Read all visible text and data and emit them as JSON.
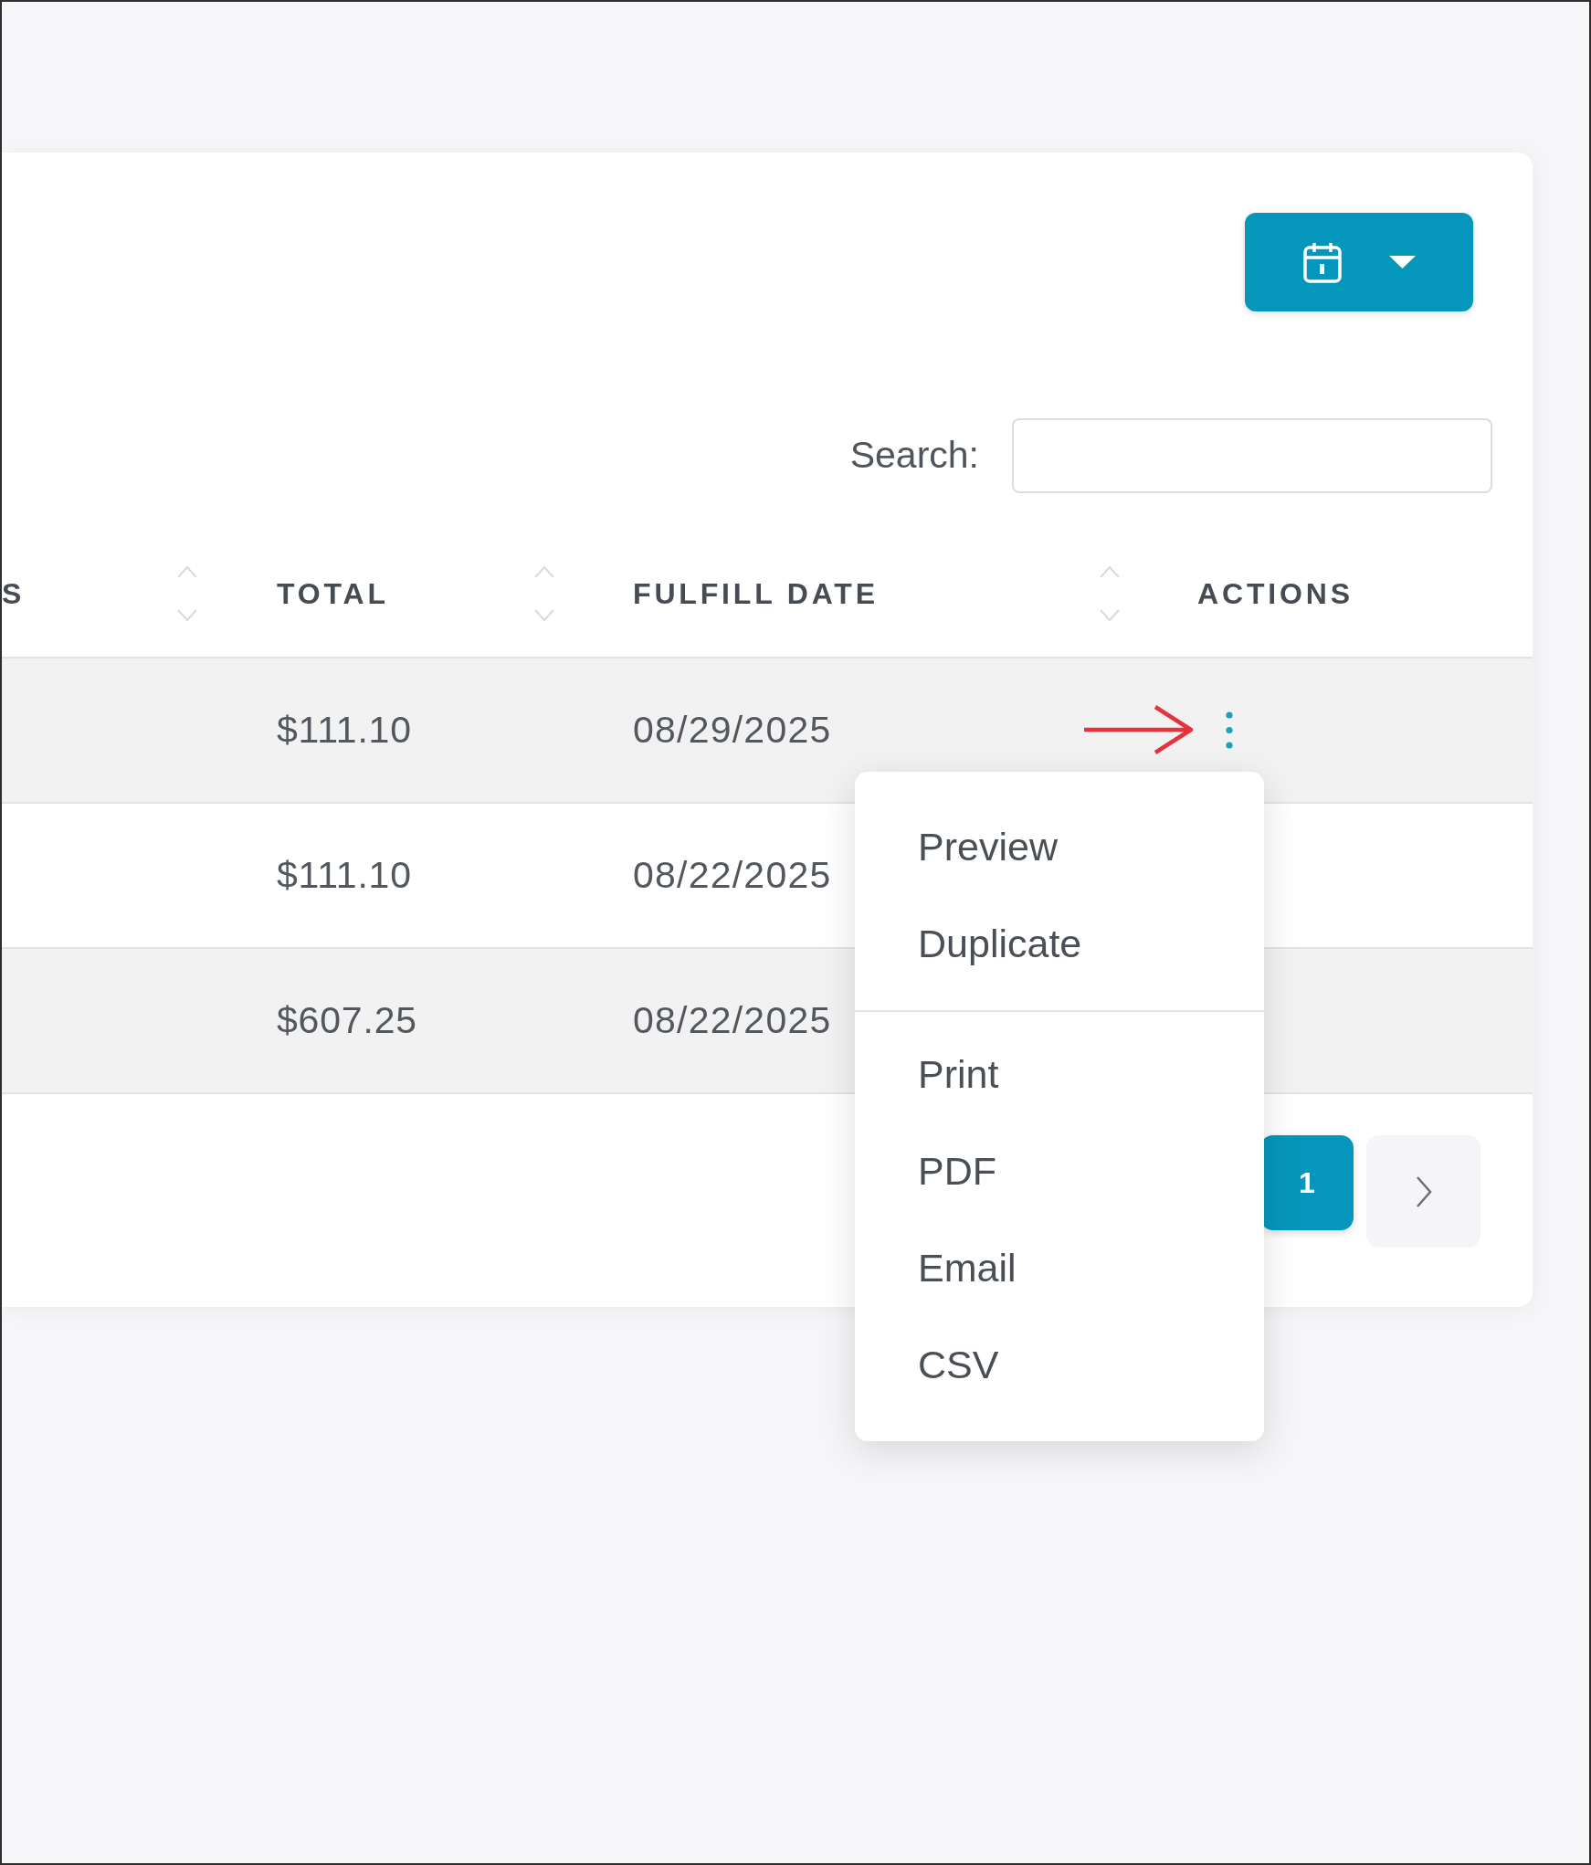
{
  "search": {
    "label": "Search:"
  },
  "table": {
    "columns": [
      {
        "label": "S",
        "sortable": true
      },
      {
        "label": "TOTAL",
        "sortable": true
      },
      {
        "label": "FULFILL DATE",
        "sortable": true
      },
      {
        "label": "ACTIONS",
        "sortable": false
      }
    ],
    "rows": [
      {
        "total": "$111.10",
        "fulfill_date": "08/29/2025",
        "menu_open": true
      },
      {
        "total": "$111.10",
        "fulfill_date": "08/22/2025",
        "menu_open": false
      },
      {
        "total": "$607.25",
        "fulfill_date": "08/22/2025",
        "menu_open": false
      }
    ]
  },
  "action_menu": {
    "sections": [
      [
        "Preview",
        "Duplicate"
      ],
      [
        "Print",
        "PDF",
        "Email",
        "CSV"
      ]
    ]
  },
  "pagination": {
    "pages": [
      {
        "label": "1",
        "selected": true
      }
    ]
  }
}
